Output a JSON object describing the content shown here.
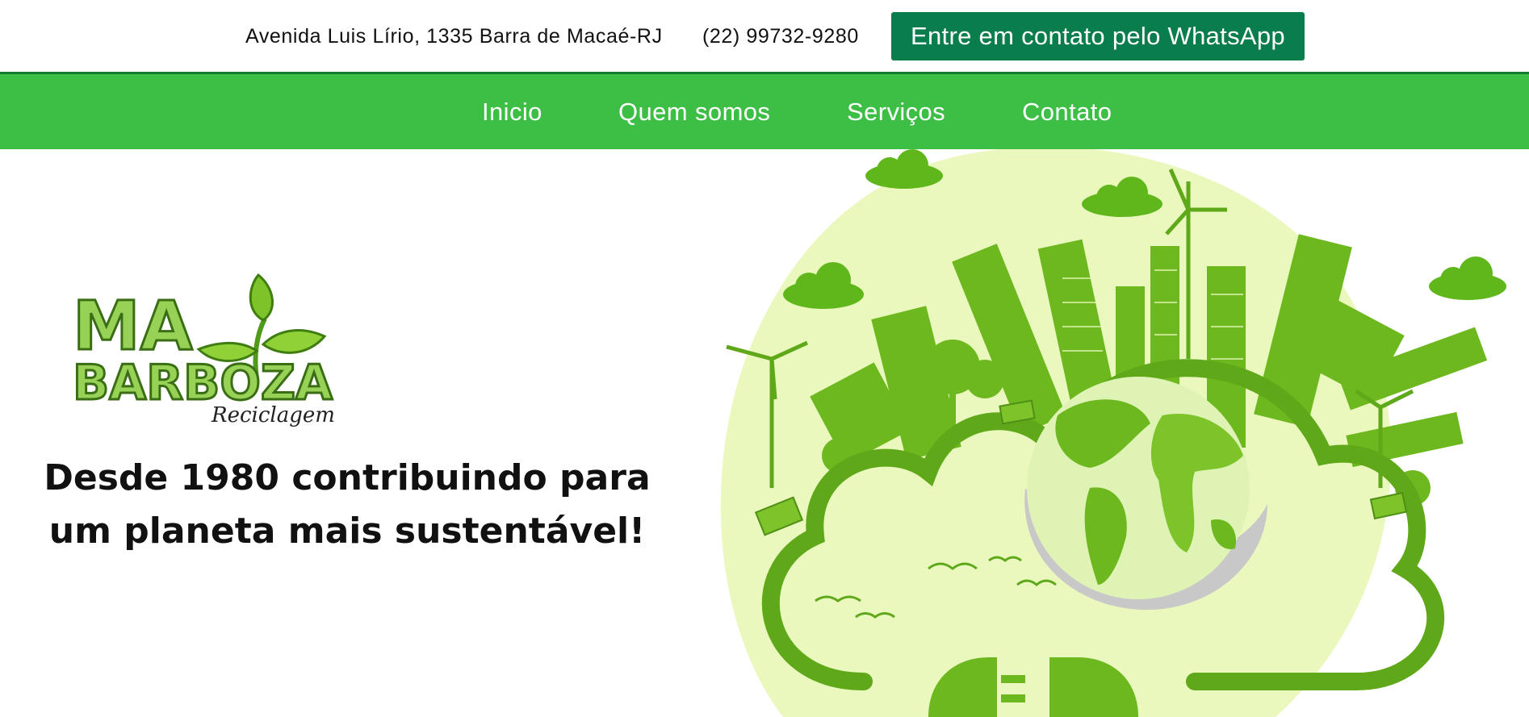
{
  "topbar": {
    "address": "Avenida Luis Lírio, 1335 Barra de Macaé-RJ",
    "phone": "(22) 99732-9280",
    "whatsapp_label": "Entre em contato pelo WhatsApp"
  },
  "nav": {
    "items": [
      {
        "label": "Inicio"
      },
      {
        "label": "Quem somos"
      },
      {
        "label": "Serviços"
      },
      {
        "label": "Contato"
      }
    ]
  },
  "hero": {
    "logo": {
      "line1": "MA",
      "line2": "BARBOZA",
      "subtitle": "Reciclagem"
    },
    "tagline_line1": "Desde 1980 contribuindo para",
    "tagline_line2": "um planeta mais sustentável!"
  },
  "colors": {
    "nav_green": "#3dbe45",
    "whatsapp_button": "#0a7d4c",
    "illustration_green": "#6cb81e",
    "illustration_background": "#eaf8bd"
  }
}
